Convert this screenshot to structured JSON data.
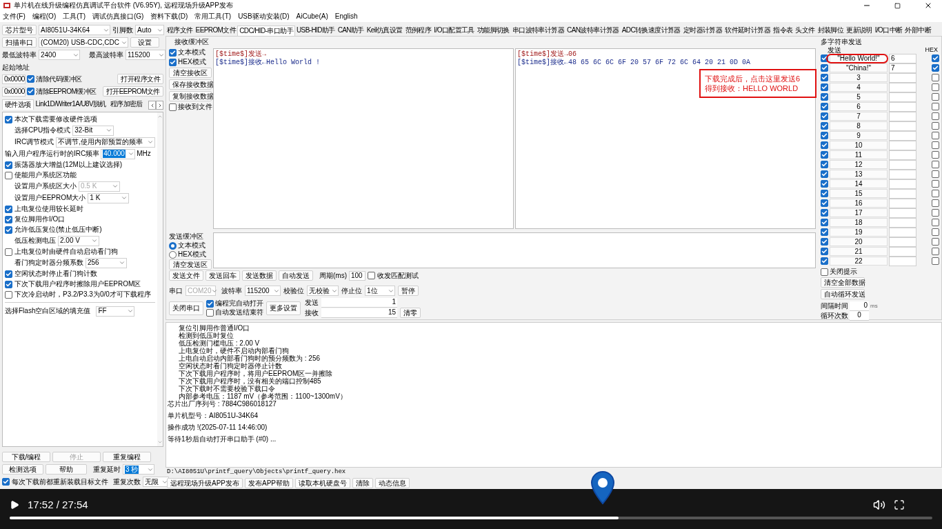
{
  "window": {
    "title": "单片机在线升级编程仿真调试平台软件 (V6.95Y), 远程现场升级APP发布"
  },
  "menu": [
    "文件(F)",
    "编程(O)",
    "工具(T)",
    "调试仿真接口(G)",
    "资料下载(D)",
    "常用工具(T)",
    "USB驱动安装(D)",
    "AiCube(A)",
    "English"
  ],
  "left_panel": {
    "chip": {
      "label": "芯片型号",
      "value": "AI8051U-34K64"
    },
    "pins": {
      "label": "引脚数",
      "value": "Auto"
    },
    "scan": {
      "label": "扫描串口",
      "value": "(COM20) USB-CDC,CDC"
    },
    "settings_button": "设置",
    "min_baud": {
      "label": "最低波特率",
      "value": "2400"
    },
    "max_baud": {
      "label": "最高波特率",
      "value": "115200"
    },
    "start_address_label": "起始地址",
    "address_rows": [
      {
        "address": "0x0000",
        "label": "清除代码缓冲区",
        "checked": true,
        "button": "打开程序文件"
      },
      {
        "address": "0x0000",
        "label": "清除EEPROM缓冲区",
        "checked": true,
        "button": "打开EEPROM文件"
      }
    ],
    "tabs": [
      {
        "label": "硬件选项",
        "selected": true
      },
      {
        "label": "Link1D/Writer1A/U8V脱机",
        "selected": false
      },
      {
        "label": "程序加密后",
        "selected": false
      }
    ],
    "options": [
      {
        "kind": "checkbox",
        "label": "本次下载需要修改硬件选项",
        "checked": true
      },
      {
        "kind": "select",
        "label": "选择CPU指令模式",
        "value": "32-Bit",
        "disabled": false
      },
      {
        "kind": "select",
        "label": "IRC调节模式",
        "value": "不调节,使用内部预置的频率",
        "disabled": false
      },
      {
        "kind": "field",
        "label": "输入用户程序运行时的IRC频率",
        "value": "40.000",
        "unit": "MHz"
      },
      {
        "kind": "checkbox",
        "label": "振荡器放大增益(12M以上建议选择)",
        "checked": true
      },
      {
        "kind": "checkbox",
        "label": "使能用户系统区功能",
        "checked": false
      },
      {
        "kind": "select",
        "label": "设置用户系统区大小",
        "value": "0.5 K",
        "disabled": true
      },
      {
        "kind": "select",
        "label": "设置用户EEPROM大小",
        "value": "1  K",
        "disabled": false
      },
      {
        "kind": "checkbox",
        "label": "上电复位使用较长延时",
        "checked": true
      },
      {
        "kind": "checkbox",
        "label": "复位脚用作I/O口",
        "checked": true
      },
      {
        "kind": "checkbox",
        "label": "允许低压复位(禁止低压中断)",
        "checked": true
      },
      {
        "kind": "select",
        "label": "低压检测电压",
        "value": "2.00 V",
        "disabled": false
      },
      {
        "kind": "checkbox",
        "label": "上电复位时由硬件自动启动看门狗",
        "checked": false
      },
      {
        "kind": "select",
        "label": "看门狗定时器分频系数",
        "value": "256",
        "disabled": false
      },
      {
        "kind": "checkbox",
        "label": "空闲状态时停止看门狗计数",
        "checked": true
      },
      {
        "kind": "checkbox",
        "label": "下次下载用户程序时擦除用户EEPROM区",
        "checked": true
      },
      {
        "kind": "checkbox",
        "label": "下次冷启动时，P3.2/P3.3为0/0才可下载程序",
        "checked": false
      }
    ],
    "fill_value": {
      "label": "选择Flash空白区域的填充值",
      "value": "FF"
    },
    "actions": [
      {
        "label": "下载/编程",
        "disabled": false
      },
      {
        "label": "停止",
        "disabled": true
      },
      {
        "label": "重复编程",
        "disabled": false
      },
      {
        "label": "检测选项",
        "disabled": false
      },
      {
        "label": "帮助",
        "disabled": false
      }
    ],
    "repeat_delay": {
      "label": "重复延时",
      "value": "3 秒"
    },
    "repeat_count": {
      "label": "重复次数",
      "value": "无限"
    },
    "reload": {
      "label": "每次下载前都重新装载目标文件",
      "checked": true
    }
  },
  "tool_tabs": [
    {
      "label": "程序文件",
      "selected": false
    },
    {
      "label": "EEPROM文件",
      "selected": false
    },
    {
      "label": "CDC/HID-串口助手",
      "selected": true
    },
    {
      "label": "USB-HID助手",
      "selected": false
    },
    {
      "label": "CAN助手",
      "selected": false
    },
    {
      "label": "Keil仿真设置",
      "selected": false
    },
    {
      "label": "范例程序",
      "selected": false
    },
    {
      "label": "I/O口配置工具",
      "selected": false
    },
    {
      "label": "功能脚切换",
      "selected": false
    },
    {
      "label": "串口波特率计算器",
      "selected": false
    },
    {
      "label": "CAN波特率计算器",
      "selected": false
    },
    {
      "label": "ADC转换速度计算器",
      "selected": false
    },
    {
      "label": "定时器计算器",
      "selected": false
    },
    {
      "label": "软件延时计算器",
      "selected": false
    },
    {
      "label": "指令表",
      "selected": false
    },
    {
      "label": "头文件",
      "selected": false
    },
    {
      "label": "封装脚位",
      "selected": false
    },
    {
      "label": "更新说明",
      "selected": false
    },
    {
      "label": "I/O口中断",
      "selected": false
    },
    {
      "label": "外部中断",
      "selected": false
    }
  ],
  "receive": {
    "title": "接收缓冲区",
    "modes": [
      {
        "label": "文本模式",
        "checked": true
      },
      {
        "label": "HEX模式",
        "checked": true
      }
    ],
    "buttons": [
      "清空接收区",
      "保存接收数据",
      "复制接收数据"
    ],
    "to_file": {
      "label": "接收到文件",
      "checked": false
    },
    "text_lines": [
      {
        "kind": "send",
        "text": "[$time$]发送→"
      },
      {
        "kind": "receive",
        "text": "[$time$]接收←Hello World !"
      }
    ],
    "hex_lines": [
      {
        "kind": "send",
        "text": "[$time$]发送→06"
      },
      {
        "kind": "receive",
        "text": "[$time$]接收←48 65 6C 6C 6F 20 57 6F 72 6C 64 20 21 0D 0A"
      }
    ]
  },
  "send": {
    "title": "发送缓冲区",
    "modes": [
      {
        "label": "文本模式",
        "selected": true
      },
      {
        "label": "HEX模式",
        "selected": false
      }
    ],
    "clear_button": "清空发送区",
    "buttons": [
      "发送文件",
      "发送回车",
      "发送数据",
      "自动发送"
    ],
    "period": {
      "label": "周期(ms)",
      "value": "100"
    },
    "match_test": {
      "label": "收发匹配测试",
      "checked": false
    }
  },
  "serial": {
    "port": {
      "label": "串口",
      "value": "COM20",
      "disabled": true
    },
    "baud": {
      "label": "波特率",
      "value": "115200"
    },
    "parity": {
      "label": "校验位",
      "value": "无校验"
    },
    "stop": {
      "label": "停止位",
      "value": "1位"
    },
    "pause_button": "暂停",
    "close_button": "关闭串口",
    "auto_open": {
      "label": "编程完自动打开",
      "checked": true
    },
    "auto_end": {
      "label": "自动发送结束符",
      "checked": false
    },
    "more_button": "更多设置",
    "sent": {
      "label": "发送",
      "value": "1"
    },
    "received": {
      "label": "接收",
      "value": "15"
    },
    "clear_button": "清零"
  },
  "multi_send": {
    "title": "多字符串发送",
    "send_header": "发送",
    "hex_header": "HEX",
    "rows": [
      {
        "enabled": true,
        "label": "\"Hello World!\"",
        "value": "6",
        "hex": true
      },
      {
        "enabled": true,
        "label": "\"China!\"",
        "value": "7",
        "hex": true
      },
      {
        "enabled": true,
        "label": "3",
        "hex": false
      },
      {
        "enabled": true,
        "label": "4",
        "hex": false
      },
      {
        "enabled": true,
        "label": "5",
        "hex": false
      },
      {
        "enabled": true,
        "label": "6",
        "hex": false
      },
      {
        "enabled": true,
        "label": "7",
        "hex": false
      },
      {
        "enabled": true,
        "label": "8",
        "hex": false
      },
      {
        "enabled": true,
        "label": "9",
        "hex": false
      },
      {
        "enabled": true,
        "label": "10",
        "hex": false
      },
      {
        "enabled": true,
        "label": "11",
        "hex": false
      },
      {
        "enabled": true,
        "label": "12",
        "hex": false
      },
      {
        "enabled": true,
        "label": "13",
        "hex": false
      },
      {
        "enabled": true,
        "label": "14",
        "hex": false
      },
      {
        "enabled": true,
        "label": "15",
        "hex": false
      },
      {
        "enabled": true,
        "label": "16",
        "hex": false
      },
      {
        "enabled": true,
        "label": "17",
        "hex": false
      },
      {
        "enabled": true,
        "label": "18",
        "hex": false
      },
      {
        "enabled": true,
        "label": "19",
        "hex": false
      },
      {
        "enabled": true,
        "label": "20",
        "hex": false
      },
      {
        "enabled": true,
        "label": "21",
        "hex": false
      },
      {
        "enabled": true,
        "label": "22",
        "hex": false
      }
    ],
    "close_hint": {
      "label": "关闭提示",
      "checked": false
    },
    "buttons": [
      "清空全部数据",
      "自动循环发送"
    ],
    "interval": {
      "label": "间隔时间",
      "value": "0",
      "unit": "ms"
    },
    "loop": {
      "label": "循环次数",
      "value": "0"
    }
  },
  "annotation": {
    "lines": [
      "下载完成后，点击这里发送6",
      "得到接收：HELLO WORLD"
    ]
  },
  "log": {
    "lines": [
      {
        "kind": "detail",
        "text": "复位引脚用作普通I/O口"
      },
      {
        "kind": "detail",
        "text": "检测到低压时复位"
      },
      {
        "kind": "detail",
        "text": "低压检测门槛电压 : 2.00 V"
      },
      {
        "kind": "detail",
        "text": "上电复位时，硬件不启动内部看门狗"
      },
      {
        "kind": "detail",
        "text": "上电自动启动内部看门狗时的预分频数为 : 256"
      },
      {
        "kind": "detail",
        "text": "空闲状态时看门狗定时器停止计数"
      },
      {
        "kind": "detail",
        "text": "下次下载用户程序时，将用户EEPROM区一并擦除"
      },
      {
        "kind": "detail",
        "text": "下次下载用户程序时，没有相关的端口控制485"
      },
      {
        "kind": "detail",
        "text": "下次下载时不需要校验下载口令"
      },
      {
        "kind": "detail",
        "text": "内部参考电压：1187 mV（参考范围：1100~1300mV）"
      },
      {
        "kind": "info",
        "text": "芯片出厂序列号 : 7884C986018127"
      },
      {
        "kind": "result",
        "text": "单片机型号：AI8051U-34K64"
      },
      {
        "kind": "result",
        "text": "操作成功 !(2025-07-11 14:46:00)"
      },
      {
        "kind": "result",
        "text": "等待1秒后自动打开串口助手 (#0) ..."
      }
    ]
  },
  "file_path": "D:\\AI8051U\\printf_query\\Objects\\printf_query.hex",
  "bottom_buttons": [
    "远程现场升级APP发布",
    "发布APP帮助",
    "读取本机硬盘号",
    "清除",
    "动态信息"
  ],
  "player": {
    "time": "17:52 / 27:54",
    "level": 0.66
  }
}
